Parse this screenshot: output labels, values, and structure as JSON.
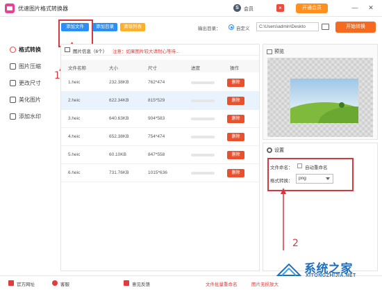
{
  "app": {
    "title": "优速图片格式转换器"
  },
  "titlebar": {
    "vip_label": "会员",
    "open_vip_label": "开通会员",
    "minimize": "—",
    "close": "✕"
  },
  "sidebar": {
    "items": [
      {
        "label": "格式转换",
        "active": true
      },
      {
        "label": "图片压缩",
        "active": false
      },
      {
        "label": "更改尺寸",
        "active": false
      },
      {
        "label": "美化图片",
        "active": false
      },
      {
        "label": "添加水印",
        "active": false
      }
    ]
  },
  "toolbar": {
    "add_file": "添加文件",
    "add_dir": "添加目录",
    "clear_list": "清除列表",
    "output_label": "输出目录：",
    "radio_label": "自定义",
    "output_path": "C:\\Users\\admin\\Deskto",
    "start_button": "开始转换"
  },
  "filelist": {
    "info_text": "图片信息（6个）",
    "warning": "注意：如果图片较大请耐心等待...",
    "columns": [
      "文件名称",
      "大小",
      "尺寸",
      "进度",
      "操作"
    ],
    "delete_label": "删除",
    "rows": [
      {
        "name": "1.heic",
        "size": "232.38KB",
        "dims": "762*474",
        "progress": 0
      },
      {
        "name": "2.heic",
        "size": "622.34KB",
        "dims": "815*529",
        "progress": 0
      },
      {
        "name": "3.heic",
        "size": "640.63KB",
        "dims": "904*583",
        "progress": 0
      },
      {
        "name": "4.heic",
        "size": "652.38KB",
        "dims": "754*474",
        "progress": 0
      },
      {
        "name": "5.heic",
        "size": "60.10KB",
        "dims": "847*558",
        "progress": 0
      },
      {
        "name": "6.heic",
        "size": "731.76KB",
        "dims": "1015*636",
        "progress": 0
      }
    ]
  },
  "preview": {
    "title": "预览"
  },
  "settings": {
    "title": "设置",
    "file_naming_label": "文件命名：",
    "auto_rename_label": "自动重命名",
    "format_label": "格式转换：",
    "format_value": "png"
  },
  "bottombar": {
    "website": "官方网址",
    "wechat": "客服",
    "feedback": "意见反馈",
    "batch_rename": "文件批量重命名",
    "lossless": "图片无损放大"
  },
  "annotations": {
    "step1": "1",
    "step2": "2"
  },
  "watermark": {
    "text": "系统之家",
    "url": "XITONGZHIJIA.NET"
  },
  "colors": {
    "accent": "#2a8ff7",
    "danger": "#e9502e",
    "start": "#f56a1f",
    "annotation": "#d7373f"
  }
}
